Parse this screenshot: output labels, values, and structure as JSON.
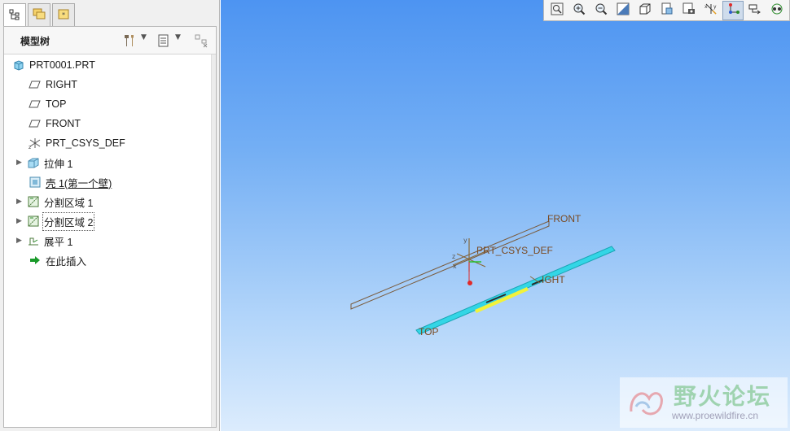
{
  "model_tree": {
    "title": "模型树",
    "tabs": [
      {
        "icon": "model-tree-tab-icon"
      },
      {
        "icon": "folder-browser-tab-icon"
      },
      {
        "icon": "favorites-tab-icon"
      }
    ],
    "header_icons": [
      "settings-tools-icon",
      "show-options-icon",
      "tree-filter-icon"
    ],
    "nodes": [
      {
        "label": "PRT0001.PRT",
        "icon": "part-icon",
        "expandable": false
      },
      {
        "label": "RIGHT",
        "icon": "datum-plane-icon",
        "expandable": false
      },
      {
        "label": "TOP",
        "icon": "datum-plane-icon",
        "expandable": false
      },
      {
        "label": "FRONT",
        "icon": "datum-plane-icon",
        "expandable": false
      },
      {
        "label": "PRT_CSYS_DEF",
        "icon": "csys-icon",
        "expandable": false
      },
      {
        "label": "拉伸 1",
        "icon": "extrude-icon",
        "expandable": true
      },
      {
        "label": "壳 1(第一个壁)",
        "icon": "shell-wall-icon",
        "expandable": false
      },
      {
        "label": "分割区域 1",
        "icon": "split-area-icon",
        "expandable": true
      },
      {
        "label": "分割区域 2",
        "icon": "split-area-icon",
        "expandable": true
      },
      {
        "label": "展平 1",
        "icon": "flatten-icon",
        "expandable": true
      },
      {
        "label": "在此插入",
        "icon": "insert-here-arrow-icon",
        "expandable": false
      }
    ]
  },
  "graphics_toolbar": {
    "buttons": [
      {
        "icon": "refit-icon"
      },
      {
        "icon": "zoom-in-icon"
      },
      {
        "icon": "zoom-out-icon"
      },
      {
        "icon": "repaint-icon"
      },
      {
        "icon": "display-style-icon"
      },
      {
        "icon": "saved-views-icon"
      },
      {
        "icon": "view-manager-icon"
      },
      {
        "icon": "datum-display-icon"
      },
      {
        "icon": "csys-display-icon",
        "pressed": true
      },
      {
        "icon": "annotation-display-icon"
      },
      {
        "icon": "spin-center-icon"
      }
    ]
  },
  "scene_labels": {
    "front": "FRONT",
    "csys": "PRT_CSYS_DEF",
    "right": "IGHT",
    "top": "TOP",
    "axis_x": "x",
    "axis_y": "y",
    "axis_z": "z"
  },
  "watermark": {
    "title": "野火论坛",
    "url": "www.proewildfire.cn"
  },
  "colors": {
    "viewport_top": "#4d94f2",
    "viewport_bottom": "#dcecfd",
    "part_cyan": "#33d6e6",
    "datum_brown": "#7a4a22"
  }
}
